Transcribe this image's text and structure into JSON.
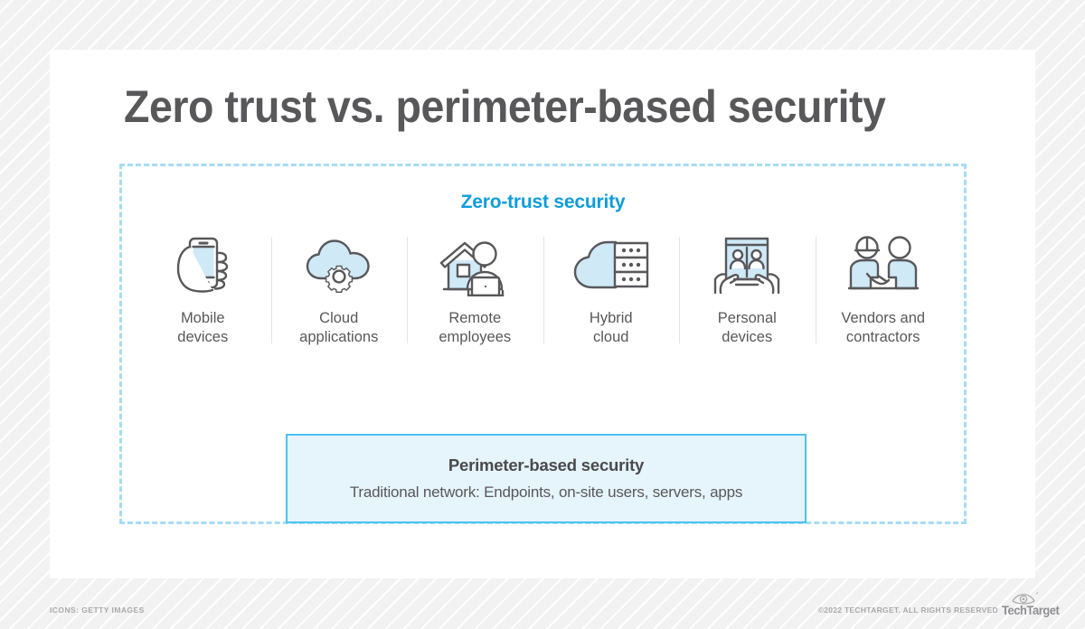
{
  "title": "Zero trust vs. perimeter-based security",
  "zero_trust": {
    "heading": "Zero-trust security",
    "items": [
      {
        "icon": "mobile-phone-in-hand-icon",
        "label": "Mobile\ndevices"
      },
      {
        "icon": "cloud-with-gear-icon",
        "label": "Cloud\napplications"
      },
      {
        "icon": "house-with-remote-worker-icon",
        "label": "Remote\nemployees"
      },
      {
        "icon": "cloud-with-servers-icon",
        "label": "Hybrid\ncloud"
      },
      {
        "icon": "tablet-in-hands-icon",
        "label": "Personal\ndevices"
      },
      {
        "icon": "handshake-people-icon",
        "label": "Vendors and\ncontractors"
      }
    ]
  },
  "perimeter": {
    "title": "Perimeter-based security",
    "subtitle": "Traditional network: Endpoints, on-site users, servers, apps"
  },
  "footer": {
    "credit": "ICONS: GETTY IMAGES",
    "copyright": "©2022 TECHTARGET. ALL RIGHTS RESERVED",
    "logo_word": "TechTarget",
    "logo_icon": "techtarget-eye-logo"
  },
  "colors": {
    "accent_blue": "#0d9ddb",
    "dashed_border": "#a6dcf7",
    "box_fill": "#e6f4fc",
    "box_border": "#4cc2ef",
    "icon_fill": "#cfe9f7",
    "icon_stroke": "#58585b",
    "text_dark": "#58585b",
    "background": "#f2f2f2"
  }
}
